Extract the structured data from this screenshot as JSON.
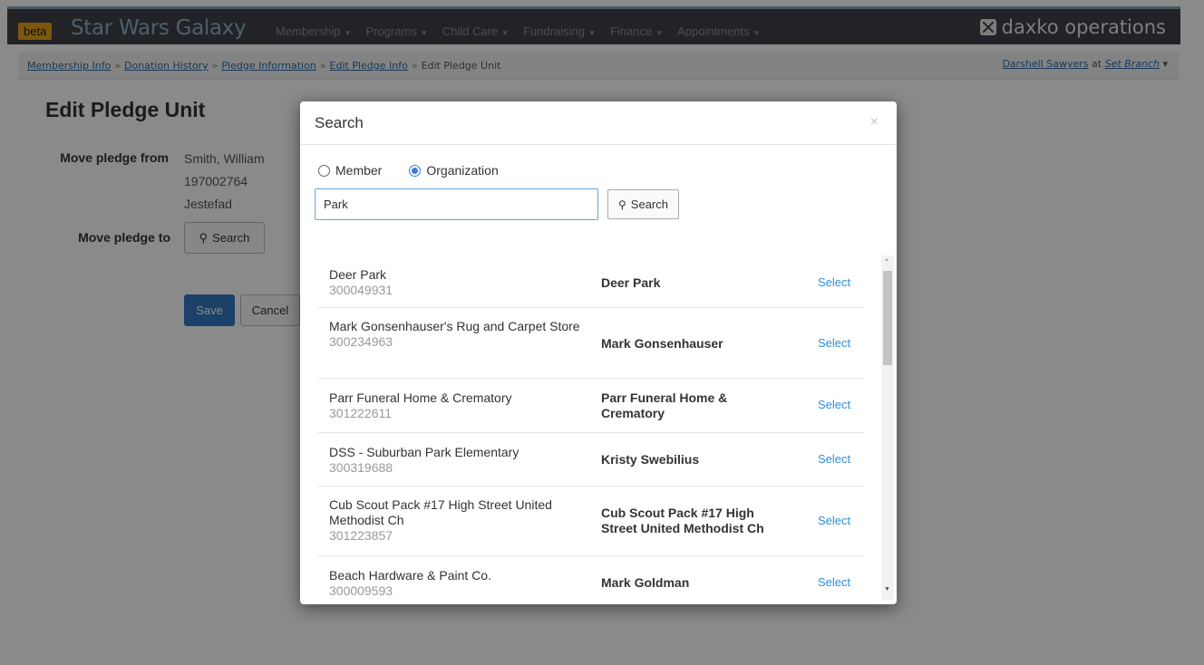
{
  "navbar": {
    "beta_label": "beta",
    "brand": "Star Wars Galaxy",
    "menu": [
      "Membership",
      "Programs",
      "Child Care",
      "Fundraising",
      "Finance",
      "Appointments"
    ],
    "logo_text": "daxko operations"
  },
  "breadcrumb": {
    "items": [
      "Membership Info",
      "Donation History",
      "Pledge Information",
      "Edit Pledge Info"
    ],
    "current": "Edit Pledge Unit",
    "separator": "»",
    "user": "Darshell Sawyers",
    "at": "at",
    "branch": "Set Branch"
  },
  "page": {
    "title": "Edit Pledge Unit",
    "from_label": "Move pledge from",
    "from_lines": [
      "Smith, William",
      "197002764",
      "Jestefad"
    ],
    "to_label": "Move pledge to",
    "search_label": "Search",
    "save_label": "Save",
    "cancel_label": "Cancel"
  },
  "modal": {
    "title": "Search",
    "close": "×",
    "radio_member": "Member",
    "radio_organization": "Organization",
    "selected_radio": "Organization",
    "search_value": "Park",
    "search_button": "Search",
    "select_label": "Select",
    "results": [
      {
        "name": "Deer Park",
        "id": "300049931",
        "contact": "Deer Park"
      },
      {
        "name": "Mark Gonsenhauser's Rug and Carpet Store",
        "id": "300234963",
        "contact": "Mark Gonsenhauser"
      },
      {
        "name": "Parr Funeral Home & Crematory",
        "id": "301222611",
        "contact": "Parr Funeral Home & Crematory"
      },
      {
        "name": "DSS - Suburban Park Elementary",
        "id": "300319688",
        "contact": "Kristy Swebilius"
      },
      {
        "name": "Cub Scout Pack #17 High Street United Methodist Ch",
        "id": "301223857",
        "contact": "Cub Scout Pack #17 High Street United Methodist Ch"
      },
      {
        "name": "Beach Hardware & Paint Co.",
        "id": "300009593",
        "contact": "Mark Goldman"
      }
    ]
  },
  "colors": {
    "navbar": "#3f4248",
    "brand": "#8fb0c8",
    "beta": "#e7a21b",
    "link": "#2b6aa6",
    "primary_button": "#3478c0",
    "select_link": "#2f8fd8"
  }
}
